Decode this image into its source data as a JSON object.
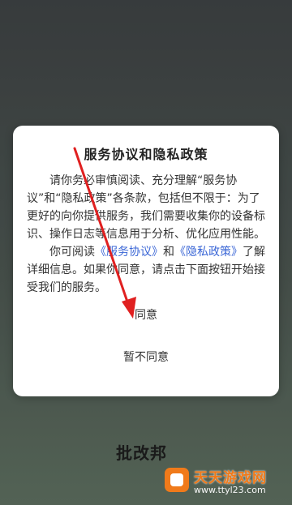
{
  "dialog": {
    "title": "服务协议和隐私政策",
    "paragraph1": "请你务必审慎阅读、充分理解“服务协议”和“隐私政策”各条款，包括但不限于：为了更好的向你提供服务，我们需要收集你的设备标识、操作日志等信息用于分析、优化应用性能。",
    "paragraph2_prefix": "你可阅读",
    "service_link": "《服务协议》",
    "and_text": "和",
    "privacy_link": "《隐私政策》",
    "paragraph2_suffix": "了解详细信息。如果你同意，请点击下面按钮开始接受我们的服务。",
    "agree_label": "同意",
    "disagree_label": "暂不同意"
  },
  "watermarks": {
    "left_text": "批改邦",
    "right_title": "天天游戏网",
    "right_url": "www.ttyl23.com"
  },
  "colors": {
    "link": "#3a66d6",
    "arrow": "#e02020",
    "watermark_orange": "#f07a1a"
  }
}
